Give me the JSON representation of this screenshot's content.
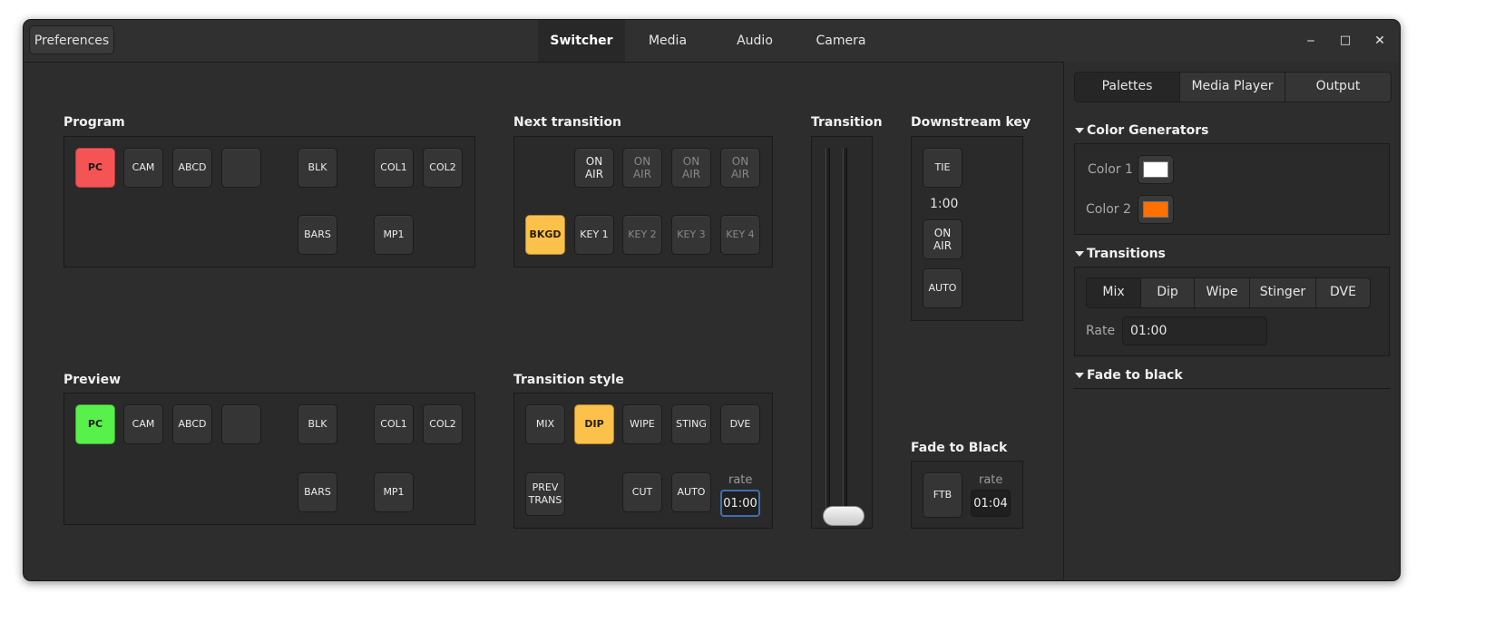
{
  "header": {
    "preferences_label": "Preferences",
    "tabs": [
      {
        "label": "Switcher",
        "active": true
      },
      {
        "label": "Media",
        "active": false
      },
      {
        "label": "Audio",
        "active": false
      },
      {
        "label": "Camera",
        "active": false
      }
    ],
    "window_controls": {
      "minimize": "‒",
      "maximize": "□",
      "close": "✕"
    }
  },
  "program": {
    "label": "Program",
    "row1": [
      "PC",
      "CAM",
      "ABCD",
      "",
      "BLK",
      "COL1",
      "COL2"
    ],
    "row2": [
      "BARS",
      "MP1"
    ],
    "active": "PC",
    "active_color": "#f55455"
  },
  "preview": {
    "label": "Preview",
    "row1": [
      "PC",
      "CAM",
      "ABCD",
      "",
      "BLK",
      "COL1",
      "COL2"
    ],
    "row2": [
      "BARS",
      "MP1"
    ],
    "active": "PC",
    "active_color": "#58f04a"
  },
  "next_transition": {
    "label": "Next transition",
    "on_air": [
      "ON AIR",
      "ON AIR",
      "ON AIR",
      "ON AIR"
    ],
    "layers": [
      "BKGD",
      "KEY 1",
      "KEY 2",
      "KEY 3",
      "KEY 4"
    ],
    "active": "BKGD"
  },
  "transition_style": {
    "label": "Transition style",
    "styles": [
      "MIX",
      "DIP",
      "WIPE",
      "STING",
      "DVE"
    ],
    "active": "DIP",
    "prev_trans": "PREV TRANS",
    "cut": "CUT",
    "auto": "AUTO",
    "rate_label": "rate",
    "rate_value": "01:00"
  },
  "transition": {
    "label": "Transition",
    "position": 1.0
  },
  "downstream_key": {
    "label": "Downstream key",
    "tie": "TIE",
    "duration": "1:00",
    "on_air": "ON AIR",
    "auto": "AUTO"
  },
  "fade_to_black": {
    "label": "Fade to Black",
    "ftb": "FTB",
    "rate_label": "rate",
    "rate_value": "01:04"
  },
  "sidebar": {
    "tabs": [
      {
        "label": "Palettes",
        "active": true
      },
      {
        "label": "Media Player",
        "active": false
      },
      {
        "label": "Output",
        "active": false
      }
    ],
    "color_generators": {
      "label": "Color Generators",
      "items": [
        {
          "label": "Color 1",
          "color": "#ffffff"
        },
        {
          "label": "Color 2",
          "color": "#ff7000"
        }
      ]
    },
    "transitions": {
      "label": "Transitions",
      "tabs": [
        "Mix",
        "Dip",
        "Wipe",
        "Stinger",
        "DVE"
      ],
      "active": "Mix",
      "rate_label": "Rate",
      "rate_value": "01:00"
    },
    "fade_to_black": {
      "label": "Fade to black"
    }
  },
  "colors": {
    "accent_yellow": "#fbc14a",
    "program_red": "#f55455",
    "preview_green": "#58f04a"
  }
}
